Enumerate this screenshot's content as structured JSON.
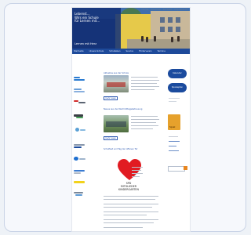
{
  "topnav": {
    "items": [
      "Home",
      "Sitemap",
      "Kontakt",
      "Impressum"
    ]
  },
  "hero": {
    "title": "Lebenst...\nWirs ein Schule\nfür Lernen mit...",
    "tagline": "Lernen mit Herz"
  },
  "mainnav": {
    "items": [
      "Startseite",
      "Unsere Schule",
      "Schulleben",
      "Service",
      "Förderverein",
      "Termine"
    ]
  },
  "content": {
    "link1": "Aktuelles aus der Schule",
    "link2": "Neues aus der Nachmittagsbetreuung",
    "link3": "Schulfest und Tag der offenen Tür",
    "more": "mehr lesen",
    "heart_caption": "SPD\nMITGLIEDER\nKINDERGARTEN"
  },
  "right": {
    "pill1": "Kalender",
    "pill2": "Speiseplan",
    "orange_label": "Spiel"
  },
  "colors": {
    "brand": "#1e4a9a",
    "accent": "#e6a12c",
    "heart": "#e11b22"
  }
}
